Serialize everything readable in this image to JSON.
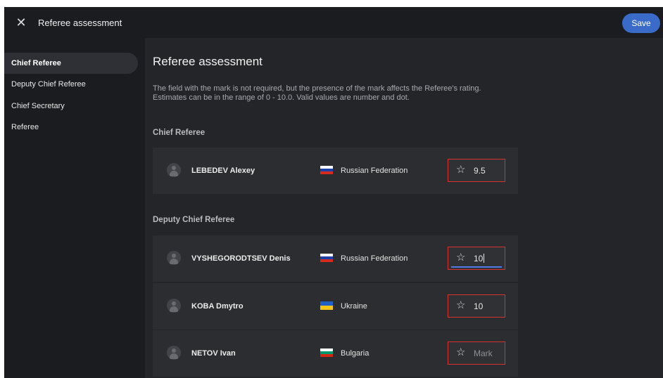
{
  "topbar": {
    "title": "Referee assessment",
    "close_icon": "close-icon",
    "save_label": "Save",
    "save_color": "#3b6bc9"
  },
  "sidebar": {
    "items": [
      {
        "label": "Chief Referee",
        "active": true
      },
      {
        "label": "Deputy Chief Referee",
        "active": false
      },
      {
        "label": "Chief Secretary",
        "active": false
      },
      {
        "label": "Referee",
        "active": false
      }
    ]
  },
  "main": {
    "title": "Referee assessment",
    "description_line1": "The field with the mark is not required, but the presence of the mark affects the Referee's rating.",
    "description_line2": "Estimates can be in the range of 0 - 10.0. Valid values are number and dot.",
    "sections": [
      {
        "title": "Chief Referee",
        "rows": [
          {
            "name": "LEBEDEV Alexey",
            "country": "Russian Federation",
            "flag": "russia-flag",
            "mark": "9.5",
            "mark_placeholder": "Mark"
          }
        ]
      },
      {
        "title": "Deputy Chief Referee",
        "rows": [
          {
            "name": "VYSHEGORODTSEV Denis",
            "country": "Russian Federation",
            "flag": "russia-flag",
            "mark": "10",
            "mark_placeholder": "Mark",
            "focused": true
          },
          {
            "name": "KOBA Dmytro",
            "country": "Ukraine",
            "flag": "ukraine-flag",
            "mark": "10",
            "mark_placeholder": "Mark"
          },
          {
            "name": "NETOV Ivan",
            "country": "Bulgaria",
            "flag": "bulgaria-flag",
            "mark": "",
            "mark_placeholder": "Mark"
          }
        ]
      }
    ]
  },
  "colors": {
    "highlight_border": "#d9312d",
    "focus_underline": "#4f7be8"
  }
}
